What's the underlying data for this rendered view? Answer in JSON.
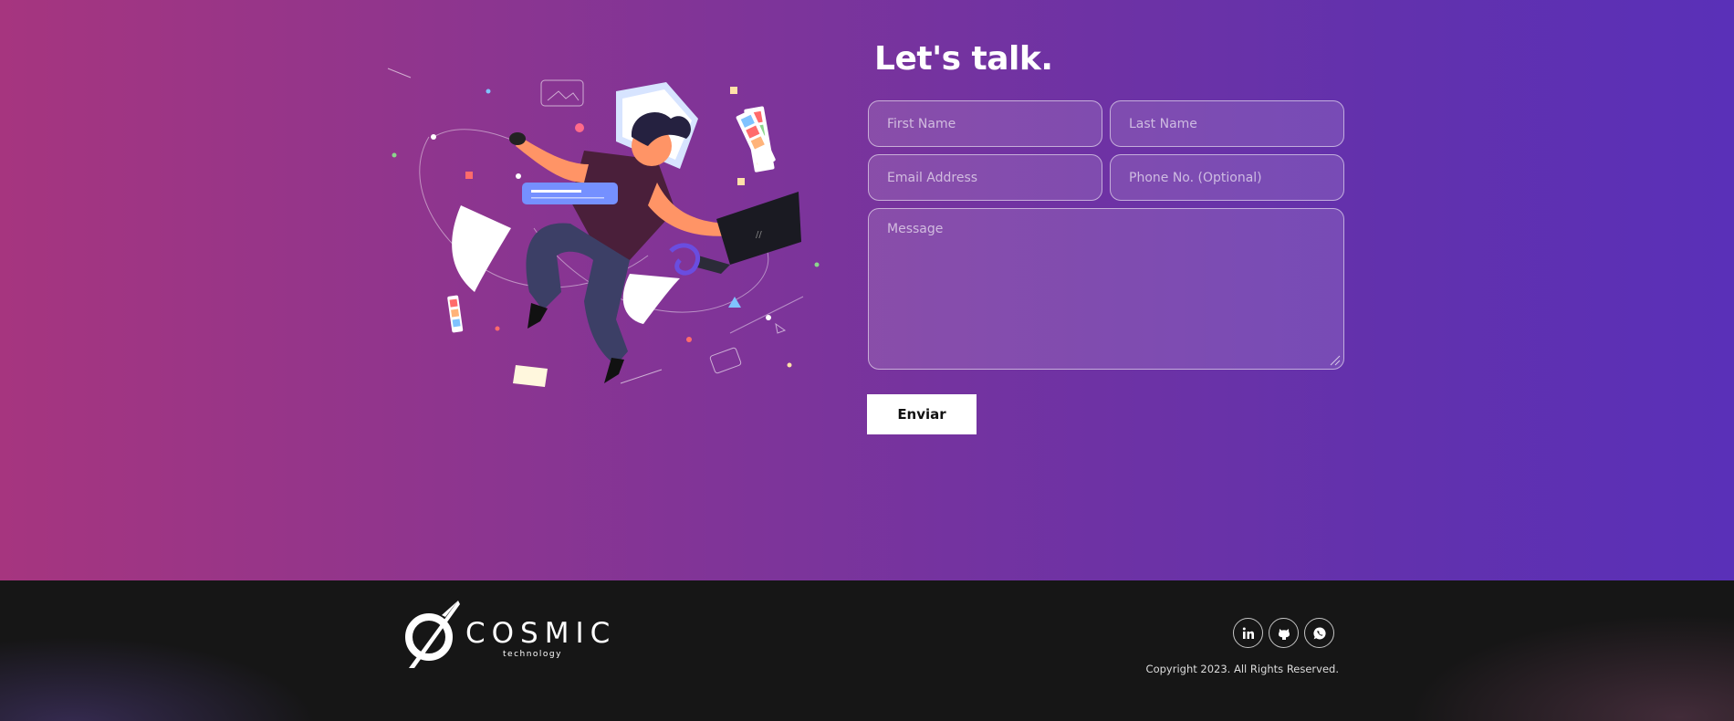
{
  "contact": {
    "heading": "Let's talk.",
    "first_name_placeholder": "First Name",
    "last_name_placeholder": "Last Name",
    "email_placeholder": "Email Address",
    "phone_placeholder": "Phone No. (Optional)",
    "message_placeholder": "Message",
    "submit_label": "Enviar"
  },
  "footer": {
    "brand_name": "COSMIC",
    "brand_tagline": "technology",
    "social_links": [
      {
        "icon": "linkedin-icon",
        "glyph": "in"
      },
      {
        "icon": "github-icon",
        "glyph": "gh"
      },
      {
        "icon": "whatsapp-icon",
        "glyph": "wa"
      }
    ],
    "copyright": "Copyright 2023. All Rights Reserved."
  },
  "colors": {
    "gradient_left": "#a6357f",
    "gradient_right": "#5a30b8",
    "footer_bg": "#161616",
    "button_bg": "#ffffff"
  }
}
